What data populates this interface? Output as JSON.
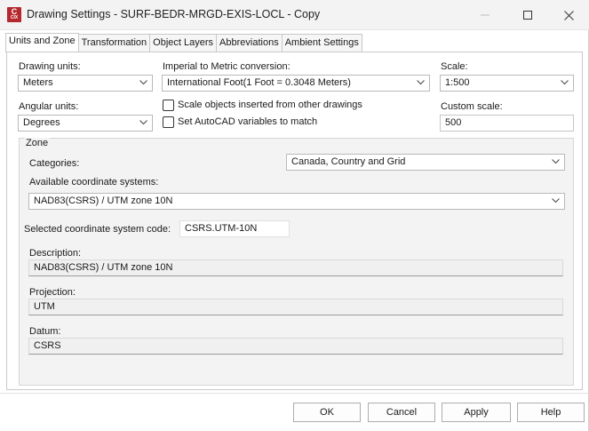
{
  "window": {
    "app_icon": {
      "top": "C",
      "bottom": "CIX"
    },
    "title": "Drawing Settings - SURF-BEDR-MRGD-EXIS-LOCL - Copy"
  },
  "tabs": [
    {
      "label": "Units and Zone",
      "active": true
    },
    {
      "label": "Transformation",
      "active": false
    },
    {
      "label": "Object Layers",
      "active": false
    },
    {
      "label": "Abbreviations",
      "active": false
    },
    {
      "label": "Ambient Settings",
      "active": false
    }
  ],
  "units": {
    "drawing_units_label": "Drawing units:",
    "drawing_units_value": "Meters",
    "angular_units_label": "Angular units:",
    "angular_units_value": "Degrees",
    "conversion_label": "Imperial to Metric conversion:",
    "conversion_value": "International Foot(1 Foot = 0.3048 Meters)",
    "scale_objects_label": "Scale objects inserted from other drawings",
    "set_variables_label": "Set AutoCAD variables to match",
    "scale_label": "Scale:",
    "scale_value": "1:500",
    "custom_scale_label": "Custom scale:",
    "custom_scale_value": "500"
  },
  "zone": {
    "group_title": "Zone",
    "categories_label": "Categories:",
    "categories_value": "Canada, Country and Grid",
    "available_label": "Available coordinate systems:",
    "available_value": "NAD83(CSRS) / UTM zone 10N",
    "selected_code_label": "Selected coordinate system code:",
    "selected_code_value": "CSRS.UTM-10N",
    "description_label": "Description:",
    "description_value": "NAD83(CSRS) / UTM zone 10N",
    "projection_label": "Projection:",
    "projection_value": "UTM",
    "datum_label": "Datum:",
    "datum_value": "CSRS"
  },
  "buttons": {
    "ok": "OK",
    "cancel": "Cancel",
    "apply": "Apply",
    "help": "Help"
  },
  "colors": {
    "app_icon": "#b5282e",
    "titlebar": "#f3f3f3",
    "group_background": "#f3f3f3"
  }
}
